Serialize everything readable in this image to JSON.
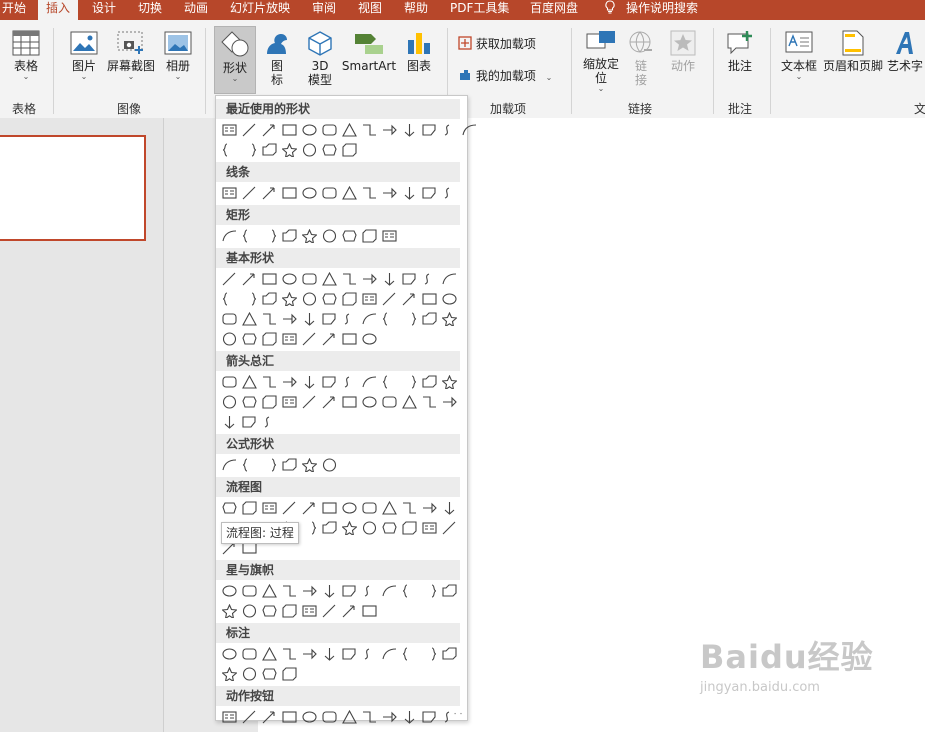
{
  "tabs": [
    {
      "label": "开始"
    },
    {
      "label": "插入",
      "active": true
    },
    {
      "label": "设计"
    },
    {
      "label": "切换"
    },
    {
      "label": "动画"
    },
    {
      "label": "幻灯片放映"
    },
    {
      "label": "审阅"
    },
    {
      "label": "视图"
    },
    {
      "label": "帮助"
    },
    {
      "label": "PDF工具集"
    },
    {
      "label": "百度网盘"
    },
    {
      "label": "操作说明搜索"
    }
  ],
  "ribbon": {
    "table": {
      "label": "表格"
    },
    "group_table": "表格",
    "picture": {
      "label": "图片"
    },
    "screenshot": {
      "label": "屏幕截图"
    },
    "album": {
      "label": "相册"
    },
    "group_image": "图像",
    "shapes": {
      "label": "形状"
    },
    "icons": {
      "label_line1": "图",
      "label_line2": "标"
    },
    "model3d": {
      "label_line1": "3D",
      "label_line2": "模型"
    },
    "smartart": {
      "label": "SmartArt"
    },
    "chart": {
      "label": "图表"
    },
    "get_addins": {
      "label": "获取加载项"
    },
    "my_addins": {
      "label": "我的加载项"
    },
    "group_addins": "加载项",
    "zoom": {
      "label_line1": "缩放定",
      "label_line2": "位"
    },
    "link": {
      "label_line1": "链",
      "label_line2": "接"
    },
    "action": {
      "label": "动作"
    },
    "group_links": "链接",
    "comment": {
      "label": "批注"
    },
    "group_comments": "批注",
    "textbox": {
      "label": "文本框"
    },
    "header_footer": {
      "label": "页眉和页脚"
    },
    "wordart": {
      "label": "艺术字"
    },
    "group_text": "文"
  },
  "shapes_panel": {
    "sections": [
      {
        "key": "recent",
        "title": "最近使用的形状",
        "rows": [
          13,
          7
        ]
      },
      {
        "key": "lines",
        "title": "线条",
        "rows": [
          12
        ]
      },
      {
        "key": "rect",
        "title": "矩形",
        "rows": [
          9
        ]
      },
      {
        "key": "basic",
        "title": "基本形状",
        "rows": [
          12,
          12,
          12,
          8
        ]
      },
      {
        "key": "arrows",
        "title": "箭头总汇",
        "rows": [
          12,
          12,
          3
        ]
      },
      {
        "key": "equation",
        "title": "公式形状",
        "rows": [
          6
        ]
      },
      {
        "key": "flowchart",
        "title": "流程图",
        "rows": [
          12,
          12,
          2
        ]
      },
      {
        "key": "stars",
        "title": "星与旗帜",
        "rows": [
          12,
          8
        ]
      },
      {
        "key": "callouts",
        "title": "标注",
        "rows": [
          12,
          4
        ]
      },
      {
        "key": "action",
        "title": "动作按钮",
        "rows": [
          12
        ]
      }
    ]
  },
  "tooltip": {
    "text": "流程图: 过程"
  },
  "watermark": {
    "brand": "Baidu经验",
    "url": "jingyan.baidu.com"
  },
  "colors": {
    "accent": "#b7472a",
    "selection_border": "#c0472b"
  }
}
